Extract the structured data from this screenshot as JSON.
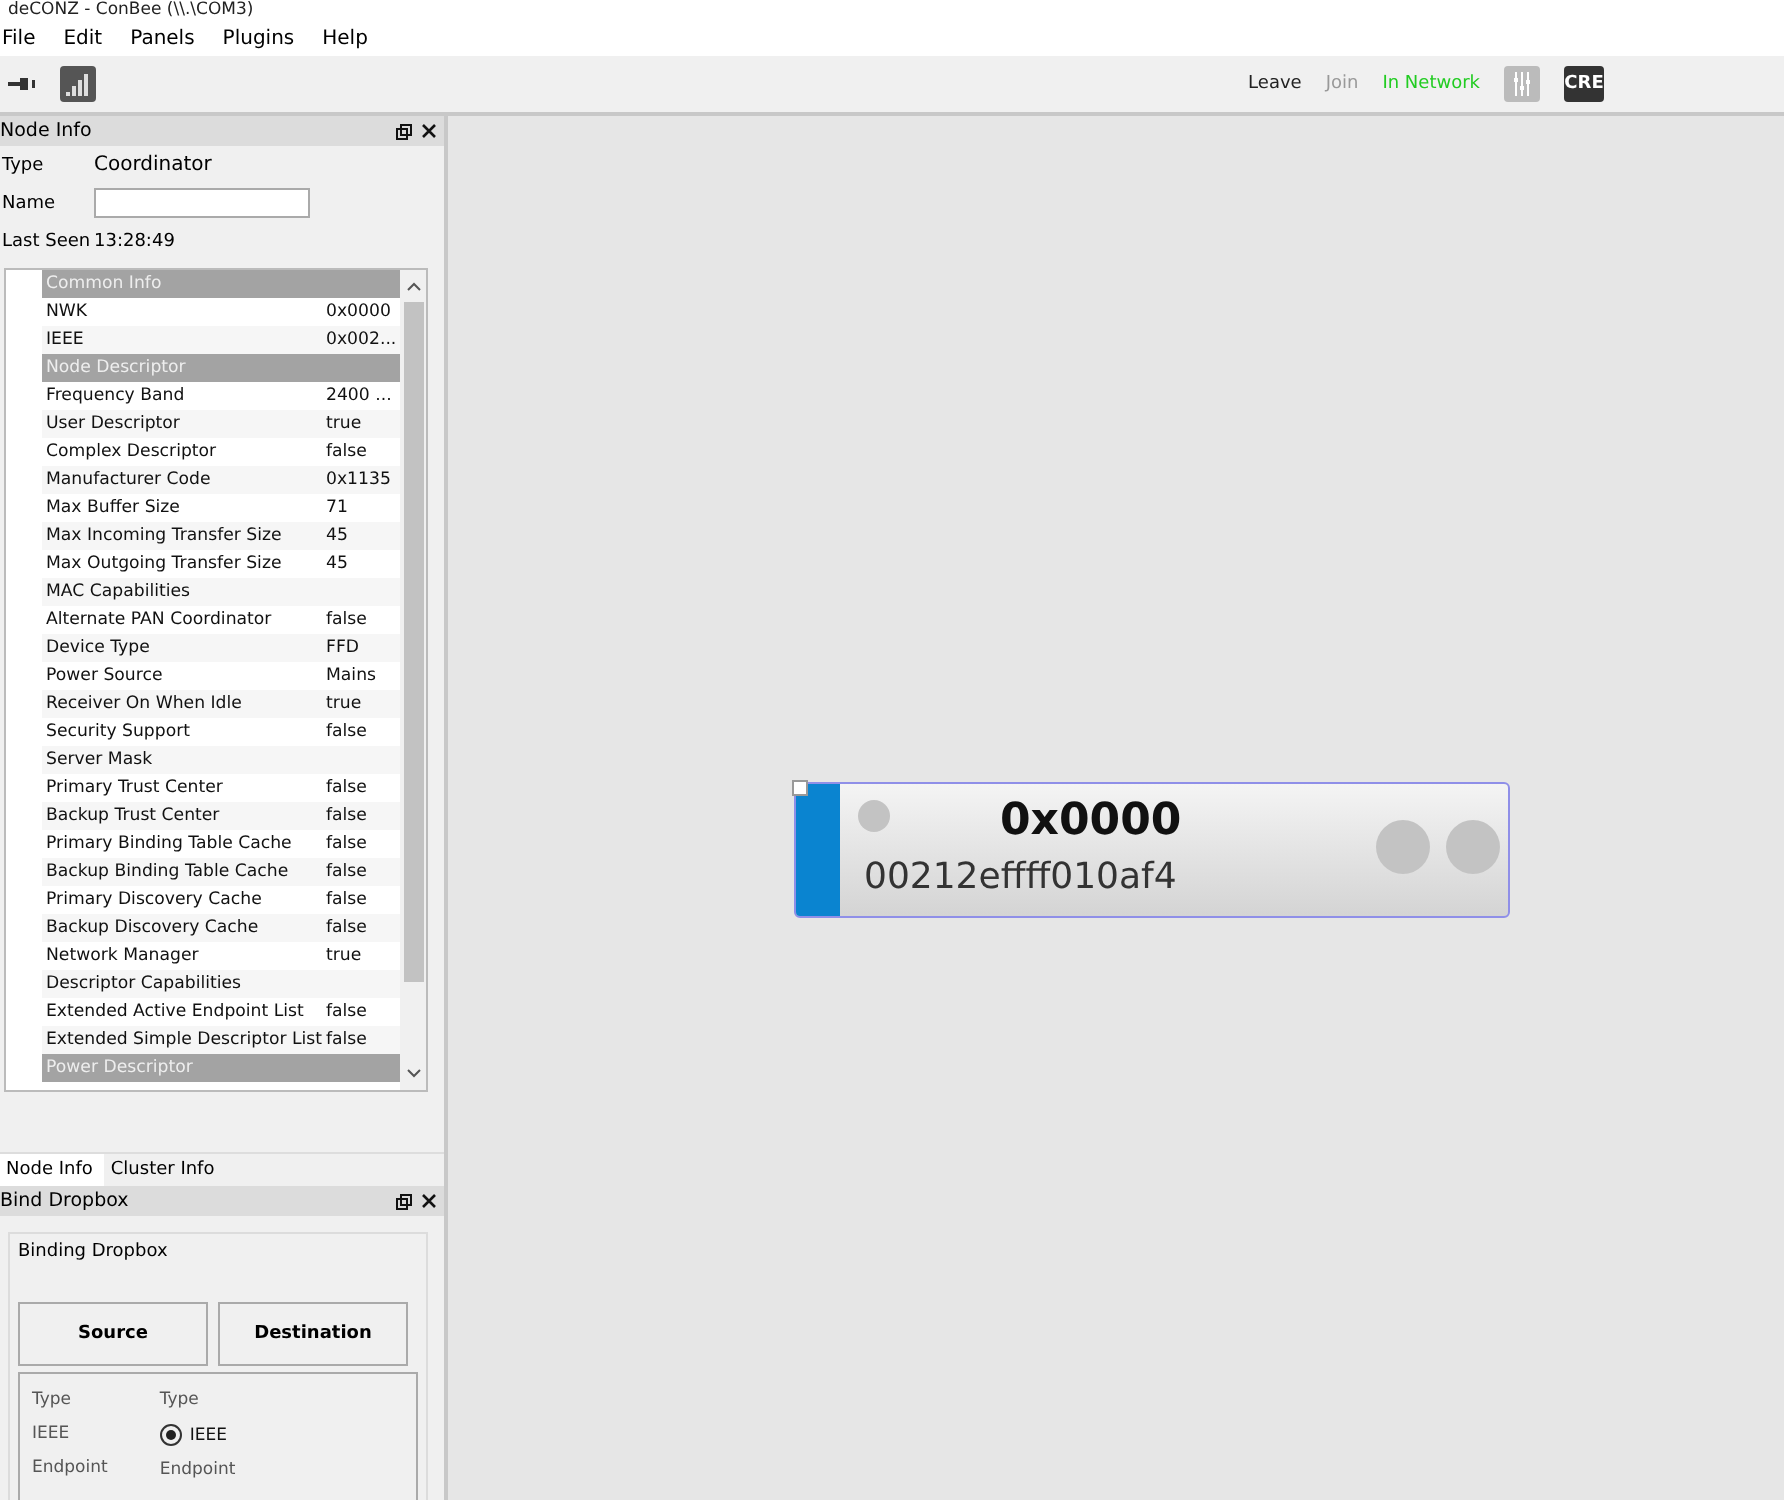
{
  "window": {
    "title": "deCONZ - ConBee (\\\\.\\COM3)"
  },
  "menu": [
    "File",
    "Edit",
    "Panels",
    "Plugins",
    "Help"
  ],
  "toolbar": {
    "right": [
      {
        "label": "Leave",
        "kind": "action",
        "disabled": false
      },
      {
        "label": "Join",
        "kind": "action",
        "disabled": true
      },
      {
        "label": "In Network",
        "kind": "status"
      }
    ],
    "badge": "CRE"
  },
  "node_info": {
    "title": "Node Info",
    "type_label": "Type",
    "type_value": "Coordinator",
    "name_label": "Name",
    "last_seen_label": "Last Seen",
    "last_seen_value": "13:28:49",
    "rows": [
      {
        "kind": "section",
        "name": "Common Info"
      },
      {
        "kind": "property",
        "name": "NWK",
        "value": "0x0000"
      },
      {
        "kind": "property",
        "name": "IEEE",
        "value": "0x002..."
      },
      {
        "kind": "section",
        "name": "Node Descriptor"
      },
      {
        "kind": "property",
        "name": "Frequency Band",
        "value": "2400 ..."
      },
      {
        "kind": "property",
        "name": "User Descriptor",
        "value": "true"
      },
      {
        "kind": "property",
        "name": "Complex Descriptor",
        "value": "false"
      },
      {
        "kind": "property",
        "name": "Manufacturer Code",
        "value": "0x1135"
      },
      {
        "kind": "property",
        "name": "Max Buffer Size",
        "value": "71"
      },
      {
        "kind": "property",
        "name": "Max Incoming Transfer Size",
        "value": "45"
      },
      {
        "kind": "property",
        "name": "Max Outgoing Transfer Size",
        "value": "45"
      },
      {
        "kind": "property",
        "name": "MAC Capabilities"
      },
      {
        "kind": "property",
        "name": "Alternate PAN Coordinator",
        "value": "false"
      },
      {
        "kind": "property",
        "name": "Device Type",
        "value": "FFD"
      },
      {
        "kind": "property",
        "name": "Power Source",
        "value": "Mains"
      },
      {
        "kind": "property",
        "name": "Receiver On When Idle",
        "value": "true"
      },
      {
        "kind": "property",
        "name": "Security Support",
        "value": "false"
      },
      {
        "kind": "property",
        "name": "Server Mask"
      },
      {
        "kind": "property",
        "name": "Primary Trust Center",
        "value": "false"
      },
      {
        "kind": "property",
        "name": "Backup Trust Center",
        "value": "false"
      },
      {
        "kind": "property",
        "name": "Primary Binding Table Cache",
        "value": "false"
      },
      {
        "kind": "property",
        "name": "Backup Binding Table Cache",
        "value": "false"
      },
      {
        "kind": "property",
        "name": "Primary Discovery Cache",
        "value": "false"
      },
      {
        "kind": "property",
        "name": "Backup Discovery Cache",
        "value": "false"
      },
      {
        "kind": "property",
        "name": "Network Manager",
        "value": "true"
      },
      {
        "kind": "property",
        "name": "Descriptor Capabilities"
      },
      {
        "kind": "property",
        "name": "Extended Active Endpoint List",
        "value": "false"
      },
      {
        "kind": "property",
        "name": "Extended Simple Descriptor List",
        "value": "false"
      },
      {
        "kind": "section",
        "name": "Power Descriptor"
      }
    ]
  },
  "tabs": [
    {
      "label": "Node Info",
      "selected": true
    },
    {
      "label": "Cluster Info",
      "selected": false
    }
  ],
  "bind_dropbox": {
    "title": "Bind Dropbox",
    "group": "Binding Dropbox",
    "buttons": [
      "Source",
      "Destination"
    ],
    "left": [
      "Type",
      "IEEE",
      "Endpoint"
    ],
    "right_type": "Type",
    "radio": {
      "label": "IEEE",
      "checked": true
    },
    "right_endpoint": "Endpoint"
  },
  "node": {
    "address": "0x0000",
    "mac": "00212effff010af4",
    "color": "#0a84d0"
  }
}
